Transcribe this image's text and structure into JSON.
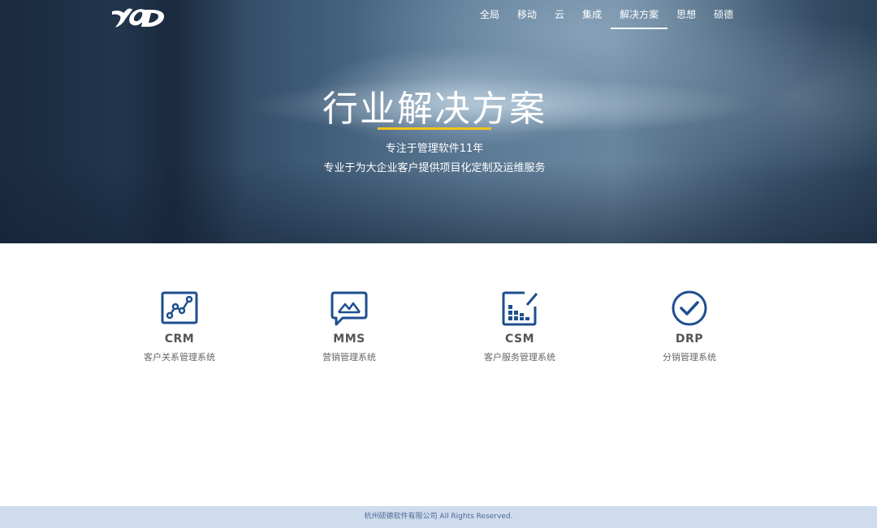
{
  "brand": {
    "logo_icon": "company-logo"
  },
  "nav": {
    "items": [
      {
        "label": "全局"
      },
      {
        "label": "移动"
      },
      {
        "label": "云"
      },
      {
        "label": "集成"
      },
      {
        "label": "解决方案",
        "active": true
      },
      {
        "label": "思想"
      },
      {
        "label": "硕德"
      }
    ]
  },
  "hero": {
    "title": "行业解决方案",
    "subtitle_1": "专注于管理软件11年",
    "subtitle_2": "专业于为大企业客户提供项目化定制及运维服务",
    "accent_color": "#f0c419"
  },
  "solutions": [
    {
      "code": "CRM",
      "description": "客户关系管理系统",
      "icon": "line-chart-icon"
    },
    {
      "code": "MMS",
      "description": "营销管理系统",
      "icon": "image-chat-icon"
    },
    {
      "code": "CSM",
      "description": "客户服务管理系统",
      "icon": "bar-chart-icon"
    },
    {
      "code": "DRP",
      "description": "分销管理系统",
      "icon": "check-circle-icon"
    }
  ],
  "icon_color": "#1d4f8f",
  "footer": {
    "copyright": "杭州硕德软件有限公司 All Rights Reserved."
  }
}
